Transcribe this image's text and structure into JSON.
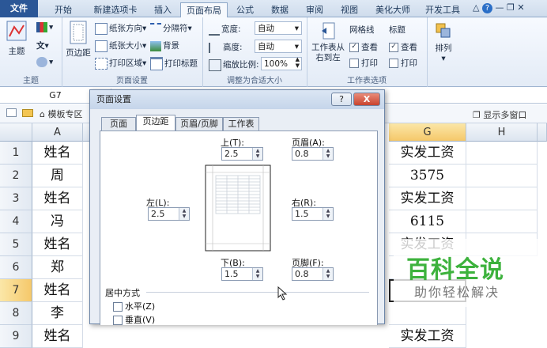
{
  "tabs": [
    "文件",
    "开始",
    "新建选项卡",
    "插入",
    "页面布局",
    "公式",
    "数据",
    "审阅",
    "视图",
    "美化大师",
    "开发工具"
  ],
  "active_tab": "页面布局",
  "ribbon": {
    "theme": {
      "main": "主题",
      "group_label": "主题"
    },
    "page_setup": {
      "margins": "页边距",
      "orientation": "纸张方向",
      "size": "纸张大小",
      "print_area": "打印区域",
      "breaks": "分隔符",
      "background": "背景",
      "print_titles": "打印标题",
      "group_label": "页面设置"
    },
    "scale": {
      "width_label": "宽度:",
      "width_value": "自动",
      "height_label": "高度:",
      "height_value": "自动",
      "scale_label": "缩放比例:",
      "scale_value": "100%",
      "group_label": "调整为合适大小"
    },
    "sheet_options": {
      "rtl": "工作表从右到左",
      "gridlines": "网格线",
      "headings": "标题",
      "view": "查看",
      "print": "打印",
      "group_label": "工作表选项"
    },
    "arrange": {
      "label": "排列"
    }
  },
  "name_box": "G7",
  "toolbar": {
    "templates": "模板专区",
    "multi_window": "显示多窗口"
  },
  "sheet": {
    "columns": [
      "A",
      "G",
      "H"
    ],
    "rows": [
      {
        "num": "1",
        "a": "姓名",
        "g": "实发工资"
      },
      {
        "num": "2",
        "a": "周",
        "g": "3575"
      },
      {
        "num": "3",
        "a": "姓名",
        "g": "实发工资"
      },
      {
        "num": "4",
        "a": "冯",
        "g": "6115"
      },
      {
        "num": "5",
        "a": "姓名",
        "g": "实发工资"
      },
      {
        "num": "6",
        "a": "郑",
        "g": ""
      },
      {
        "num": "7",
        "a": "姓名",
        "g": ""
      },
      {
        "num": "8",
        "a": "李",
        "g": ""
      },
      {
        "num": "9",
        "a": "姓名",
        "g": "实发工资"
      }
    ]
  },
  "dialog": {
    "title": "页面设置",
    "help": "?",
    "close": "X",
    "tabs": [
      "页面",
      "页边距",
      "页眉/页脚",
      "工作表"
    ],
    "active_tab": "页边距",
    "top_label": "上(T):",
    "top_value": "2.5",
    "header_label": "页眉(A):",
    "header_value": "0.8",
    "left_label": "左(L):",
    "left_value": "2.5",
    "right_label": "右(R):",
    "right_value": "1.5",
    "bottom_label": "下(B):",
    "bottom_value": "1.5",
    "footer_label": "页脚(F):",
    "footer_value": "0.8",
    "center_title": "居中方式",
    "horizontal": "水平(Z)",
    "vertical": "垂直(V)"
  },
  "watermark": {
    "title": "百科全说",
    "subtitle": "助你轻松解决"
  },
  "colors": {
    "file_tab": "#2b5797",
    "selected_header": "#f5c86a",
    "watermark": "#3db23d"
  }
}
